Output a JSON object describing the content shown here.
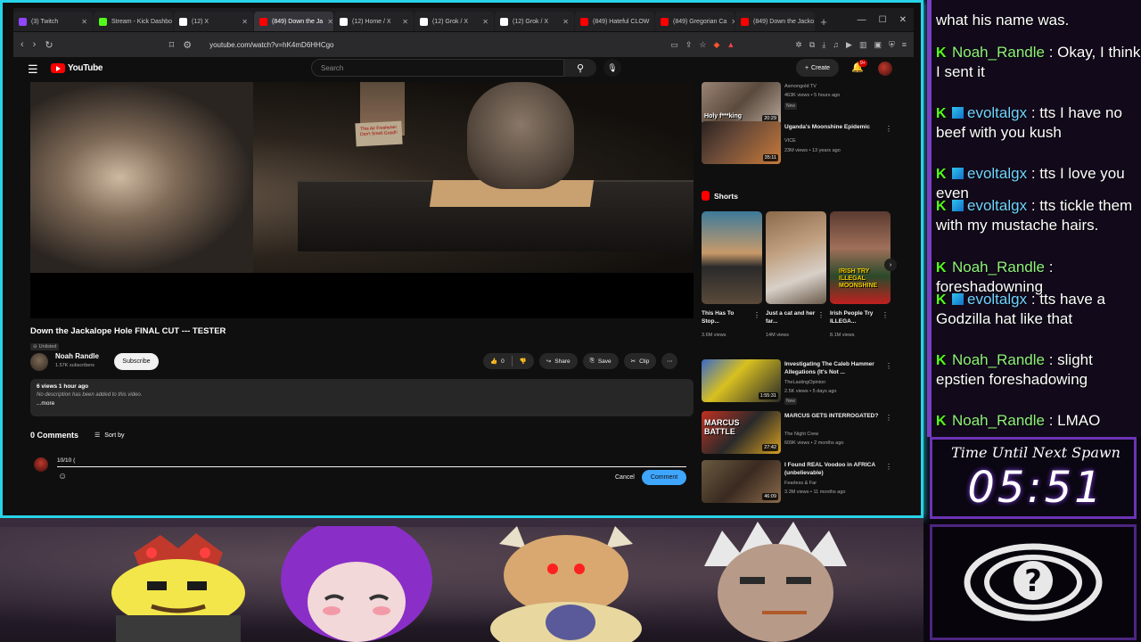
{
  "browser": {
    "tabs": [
      {
        "label": "(3) Twitch",
        "color": "#9146ff",
        "active": false
      },
      {
        "label": "Stream - Kick Dashbo",
        "color": "#53fc18",
        "active": false
      },
      {
        "label": "(12) X",
        "color": "#ffffff",
        "active": false
      },
      {
        "label": "(849) Down the Ja",
        "color": "#ff0000",
        "active": true
      },
      {
        "label": "(12) Home / X",
        "color": "#ffffff",
        "active": false
      },
      {
        "label": "(12) Grok / X",
        "color": "#ffffff",
        "active": false
      },
      {
        "label": "(12) Grok / X",
        "color": "#ffffff",
        "active": false
      },
      {
        "label": "(849) Hateful CLOW",
        "color": "#ff0000",
        "active": false
      },
      {
        "label": "(849) Gregorian Ca",
        "color": "#ff0000",
        "active": false
      },
      {
        "label": "(849) Down the Jacko",
        "color": "#ff0000",
        "active": false
      }
    ],
    "url": "youtube.com/watch?v=hK4mD6HHCgo"
  },
  "youtube": {
    "logo_text": "YouTube",
    "search_placeholder": "Search",
    "create_label": "Create",
    "notif_badge": "9+",
    "video": {
      "title": "Down the Jackalope Hole FINAL CUT --- TESTER",
      "visibility": "Unlisted",
      "frame_caption": "This Air Freshener Don't Smell Good!!"
    },
    "channel": {
      "name": "Noah Randle",
      "subs": "1.57K subscribers",
      "subscribe_label": "Subscribe"
    },
    "actions": {
      "likes": "0",
      "share": "Share",
      "save": "Save",
      "clip": "Clip"
    },
    "description": {
      "stats": "6 views  1 hour ago",
      "text": "No description has been added to this video.",
      "more": "...more"
    },
    "comments": {
      "count_label": "0 Comments",
      "sort_label": "Sort by",
      "draft": "10/10 (",
      "cancel": "Cancel",
      "submit": "Comment"
    },
    "sidebar": {
      "recs": [
        {
          "title": "",
          "thumb_text": "Holy f***king",
          "duration": "20:29",
          "channel": "Asmongold TV",
          "meta": "463K views • 5 hours ago",
          "badge": "New"
        },
        {
          "title": "Uganda's Moonshine Epidemic",
          "duration": "35:11",
          "channel": "VICE",
          "meta": "23M views • 13 years ago",
          "badge": ""
        },
        {
          "title": "Investigating The Caleb Hammer Allegations (It's Not ...",
          "duration": "1:55:31",
          "channel": "TheLastingOpinion",
          "meta": "2.5K views • 5 days ago",
          "badge": "New"
        },
        {
          "title": "MARCUS GETS INTERROGATED?",
          "duration": "27:42",
          "channel": "The Night Crew",
          "meta": "609K views • 2 months ago",
          "badge": ""
        },
        {
          "title": "I Found REAL Voodoo in AFRICA (unbelievable)",
          "duration": "46:09",
          "channel": "Fearless & Far",
          "meta": "3.3M views • 11 months ago",
          "badge": ""
        }
      ],
      "shorts_label": "Shorts",
      "shorts": [
        {
          "title": "This Has To Stop...",
          "views": "3.6M views"
        },
        {
          "title": "Just a cat and her far...",
          "views": "14M views"
        },
        {
          "title": "Irish People Try ILLEGA...",
          "views": "8.1M views"
        }
      ]
    }
  },
  "chat": {
    "messages": [
      {
        "user": "",
        "text": "what his name was.",
        "alt": false
      },
      {
        "user": "Noah_Randle",
        "text": "Okay, I think I sent it",
        "alt": false
      },
      {
        "user": "evoltalgx",
        "text": "tts I have no beef with you kush",
        "alt": true
      },
      {
        "user": "evoltalgx",
        "text": "tts I love you even",
        "alt": true
      },
      {
        "user": "evoltalgx",
        "text": "tts tickle them with my mustache hairs.",
        "alt": true
      },
      {
        "user": "Noah_Randle",
        "text": "foreshadowning",
        "alt": false
      },
      {
        "user": "evoltalgx",
        "text": "tts have a Godzilla hat like that",
        "alt": true
      },
      {
        "user": "Noah_Randle",
        "text": "slight epstien foreshadowing",
        "alt": false
      },
      {
        "user": "Noah_Randle",
        "text": "LMAO",
        "alt": false
      }
    ]
  },
  "timer": {
    "label": "Time Until Next Spawn",
    "value": "05:51"
  },
  "colors": {
    "frame": "#27d4e8",
    "kick_green": "#53fc18",
    "purple": "#7b3fc4",
    "yt_red": "#ff0000",
    "comment_blue": "#3ea6ff"
  }
}
